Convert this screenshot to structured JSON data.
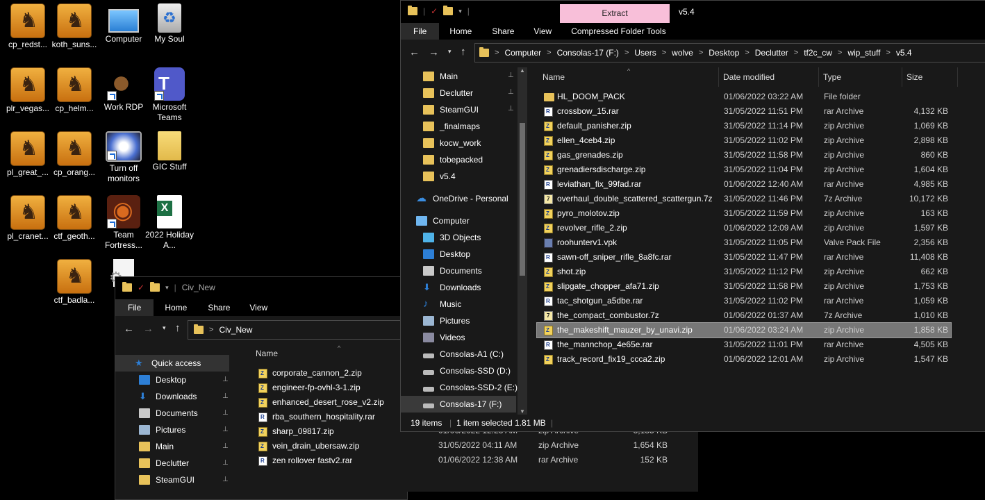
{
  "desktop": {
    "icons": [
      {
        "label": "cp_redst...",
        "kind": "game"
      },
      {
        "label": "koth_suns...",
        "kind": "game"
      },
      {
        "label": "Computer",
        "kind": "computer"
      },
      {
        "label": "My Soul",
        "kind": "recycle"
      },
      {
        "label": "plr_vegas...",
        "kind": "game"
      },
      {
        "label": "cp_helm...",
        "kind": "game"
      },
      {
        "label": "Work RDP",
        "kind": "poop"
      },
      {
        "label": "Microsoft Teams",
        "kind": "teams"
      },
      {
        "label": "pl_great_...",
        "kind": "game"
      },
      {
        "label": "cp_orang...",
        "kind": "game"
      },
      {
        "label": "Turn off monitors",
        "kind": "monitor"
      },
      {
        "label": "GIC Stuff",
        "kind": "folder"
      },
      {
        "label": "pl_cranet...",
        "kind": "game"
      },
      {
        "label": "ctf_geoth...",
        "kind": "game"
      },
      {
        "label": "Team Fortress...",
        "kind": "tf2"
      },
      {
        "label": "2022 Holiday A...",
        "kind": "excel"
      },
      {
        "label": "ctf_badla...",
        "kind": "game"
      },
      {
        "label": "ad",
        "kind": "file"
      }
    ]
  },
  "back_window": {
    "title": "Civ_New",
    "tabs": [
      "File",
      "Home",
      "Share",
      "View"
    ],
    "address": [
      "Civ_New"
    ],
    "nav": [
      {
        "label": "Quick access",
        "icon": "star-icon",
        "pinned": false
      },
      {
        "label": "Desktop",
        "icon": "desktop-icon",
        "pinned": true
      },
      {
        "label": "Downloads",
        "icon": "download-icon",
        "pinned": true
      },
      {
        "label": "Documents",
        "icon": "documents-icon",
        "pinned": true
      },
      {
        "label": "Pictures",
        "icon": "pictures-icon",
        "pinned": true
      },
      {
        "label": "Main",
        "icon": "folder-icon",
        "pinned": true
      },
      {
        "label": "Declutter",
        "icon": "folder-icon",
        "pinned": true
      },
      {
        "label": "SteamGUI",
        "icon": "folder-icon",
        "pinned": true
      }
    ],
    "column_name": "Name",
    "files": [
      {
        "name": "corporate_cannon_2.zip",
        "date": "",
        "type": "",
        "size": "",
        "icon": "zip"
      },
      {
        "name": "engineer-fp-ovhl-3-1.zip",
        "date": "",
        "type": "",
        "size": "",
        "icon": "zip"
      },
      {
        "name": "enhanced_desert_rose_v2.zip",
        "date": "",
        "type": "",
        "size": "",
        "icon": "zip"
      },
      {
        "name": "rba_southern_hospitality.rar",
        "date": "",
        "type": "",
        "size": "",
        "icon": "rar"
      },
      {
        "name": "sharp_09817.zip",
        "date": "01/06/2022 12:23 AM",
        "type": "zip Archive",
        "size": "3,185 KB",
        "icon": "zip"
      },
      {
        "name": "vein_drain_ubersaw.zip",
        "date": "31/05/2022 04:11 AM",
        "type": "zip Archive",
        "size": "1,654 KB",
        "icon": "zip"
      },
      {
        "name": "zen rollover fastv2.rar",
        "date": "01/06/2022 12:38 AM",
        "type": "rar Archive",
        "size": "152 KB",
        "icon": "rar"
      }
    ]
  },
  "front_window": {
    "title": "v5.4",
    "context_tab": "Extract",
    "tabs": [
      "File",
      "Home",
      "Share",
      "View",
      "Compressed Folder Tools"
    ],
    "address": [
      "Computer",
      "Consolas-17 (F:)",
      "Users",
      "wolve",
      "Desktop",
      "Declutter",
      "tf2c_cw",
      "wip_stuff",
      "v5.4"
    ],
    "nav": [
      {
        "label": "Main",
        "icon": "folder-icon",
        "pinned": true,
        "indent": 1
      },
      {
        "label": "Declutter",
        "icon": "folder-icon",
        "pinned": true,
        "indent": 1
      },
      {
        "label": "SteamGUI",
        "icon": "folder-icon",
        "pinned": true,
        "indent": 1
      },
      {
        "label": "_finalmaps",
        "icon": "folder-icon",
        "pinned": false,
        "indent": 1
      },
      {
        "label": "kocw_work",
        "icon": "folder-icon",
        "pinned": false,
        "indent": 1
      },
      {
        "label": "tobepacked",
        "icon": "folder-icon",
        "pinned": false,
        "indent": 1
      },
      {
        "label": "v5.4",
        "icon": "folder-icon",
        "pinned": false,
        "indent": 1
      },
      {
        "label": "OneDrive - Personal",
        "icon": "cloud-icon",
        "pinned": false,
        "indent": 0
      },
      {
        "label": "Computer",
        "icon": "computer-icon",
        "pinned": false,
        "indent": 0
      },
      {
        "label": "3D Objects",
        "icon": "cube-icon",
        "pinned": false,
        "indent": 1
      },
      {
        "label": "Desktop",
        "icon": "desktop-icon",
        "pinned": false,
        "indent": 1
      },
      {
        "label": "Documents",
        "icon": "documents-icon",
        "pinned": false,
        "indent": 1
      },
      {
        "label": "Downloads",
        "icon": "download-icon",
        "pinned": false,
        "indent": 1
      },
      {
        "label": "Music",
        "icon": "music-icon",
        "pinned": false,
        "indent": 1
      },
      {
        "label": "Pictures",
        "icon": "pictures-icon",
        "pinned": false,
        "indent": 1
      },
      {
        "label": "Videos",
        "icon": "video-icon",
        "pinned": false,
        "indent": 1
      },
      {
        "label": "Consolas-A1 (C:)",
        "icon": "drive-icon",
        "pinned": false,
        "indent": 1
      },
      {
        "label": "Consolas-SSD (D:)",
        "icon": "drive-icon",
        "pinned": false,
        "indent": 1
      },
      {
        "label": "Consolas-SSD-2 (E:)",
        "icon": "drive-icon",
        "pinned": false,
        "indent": 1
      },
      {
        "label": "Consolas-17 (F:)",
        "icon": "drive-icon",
        "pinned": false,
        "indent": 1,
        "selected": true
      }
    ],
    "columns": {
      "name": "Name",
      "date": "Date modified",
      "type": "Type",
      "size": "Size"
    },
    "files": [
      {
        "name": "HL_DOOM_PACK",
        "date": "01/06/2022 03:22 AM",
        "type": "File folder",
        "size": "",
        "icon": "folder"
      },
      {
        "name": "crossbow_15.rar",
        "date": "31/05/2022 11:51 PM",
        "type": "rar Archive",
        "size": "4,132 KB",
        "icon": "rar"
      },
      {
        "name": "default_panisher.zip",
        "date": "31/05/2022 11:14 PM",
        "type": "zip Archive",
        "size": "1,069 KB",
        "icon": "zip"
      },
      {
        "name": "ellen_4ceb4.zip",
        "date": "31/05/2022 11:02 PM",
        "type": "zip Archive",
        "size": "2,898 KB",
        "icon": "zip"
      },
      {
        "name": "gas_grenades.zip",
        "date": "31/05/2022 11:58 PM",
        "type": "zip Archive",
        "size": "860 KB",
        "icon": "zip"
      },
      {
        "name": "grenadiersdischarge.zip",
        "date": "31/05/2022 11:04 PM",
        "type": "zip Archive",
        "size": "1,604 KB",
        "icon": "zip"
      },
      {
        "name": "leviathan_fix_99fad.rar",
        "date": "01/06/2022 12:40 AM",
        "type": "rar Archive",
        "size": "4,985 KB",
        "icon": "rar"
      },
      {
        "name": "overhaul_double_scattered_scattergun.7z",
        "date": "31/05/2022 11:46 PM",
        "type": "7z Archive",
        "size": "10,172 KB",
        "icon": "7z"
      },
      {
        "name": "pyro_molotov.zip",
        "date": "31/05/2022 11:59 PM",
        "type": "zip Archive",
        "size": "163 KB",
        "icon": "zip"
      },
      {
        "name": "revolver_rifle_2.zip",
        "date": "01/06/2022 12:09 AM",
        "type": "zip Archive",
        "size": "1,597 KB",
        "icon": "zip"
      },
      {
        "name": "roohunterv1.vpk",
        "date": "31/05/2022 11:05 PM",
        "type": "Valve Pack File",
        "size": "2,356 KB",
        "icon": "vpk"
      },
      {
        "name": "sawn-off_sniper_rifle_8a8fc.rar",
        "date": "31/05/2022 11:47 PM",
        "type": "rar Archive",
        "size": "11,408 KB",
        "icon": "rar"
      },
      {
        "name": "shot.zip",
        "date": "31/05/2022 11:12 PM",
        "type": "zip Archive",
        "size": "662 KB",
        "icon": "zip"
      },
      {
        "name": "slipgate_chopper_afa71.zip",
        "date": "31/05/2022 11:58 PM",
        "type": "zip Archive",
        "size": "1,753 KB",
        "icon": "zip"
      },
      {
        "name": "tac_shotgun_a5dbe.rar",
        "date": "31/05/2022 11:02 PM",
        "type": "rar Archive",
        "size": "1,059 KB",
        "icon": "rar"
      },
      {
        "name": "the_compact_combustor.7z",
        "date": "01/06/2022 01:37 AM",
        "type": "7z Archive",
        "size": "1,010 KB",
        "icon": "7z"
      },
      {
        "name": "the_makeshift_mauzer_by_unavi.zip",
        "date": "01/06/2022 03:24 AM",
        "type": "zip Archive",
        "size": "1,858 KB",
        "icon": "zip",
        "selected": true
      },
      {
        "name": "the_mannchop_4e65e.rar",
        "date": "31/05/2022 11:01 PM",
        "type": "rar Archive",
        "size": "4,505 KB",
        "icon": "rar"
      },
      {
        "name": "track_record_fix19_ccca2.zip",
        "date": "01/06/2022 12:01 AM",
        "type": "zip Archive",
        "size": "1,547 KB",
        "icon": "zip"
      }
    ],
    "status": {
      "count": "19 items",
      "selection": "1 item selected",
      "size": "1.81 MB"
    }
  }
}
